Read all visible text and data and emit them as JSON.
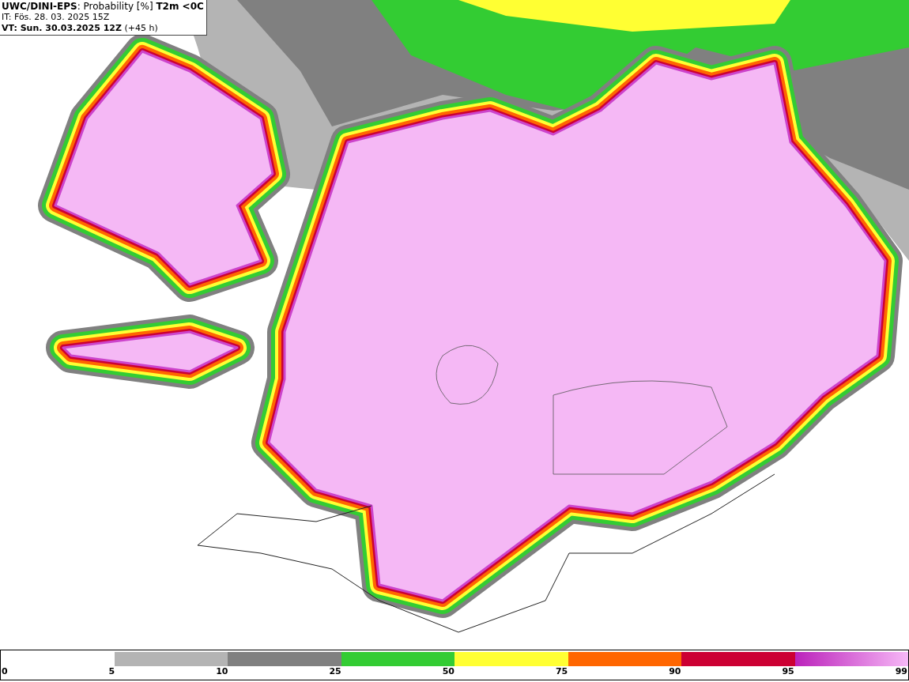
{
  "header": {
    "lines": [
      "**UWC/DINI-EPS**: Probability [%] **T2m <0C**",
      "IT: Fös. 28. 03. 2025 15Z",
      "**VT: Sun. 30.03.2025 12Z** (+45 h)"
    ]
  },
  "legend": {
    "segments": [
      {
        "color": "#ffffff"
      },
      {
        "color": "#b4b4b4"
      },
      {
        "color": "#808080"
      },
      {
        "color": "#33cc33"
      },
      {
        "color": "#ffff33"
      },
      {
        "color": "#ff6600"
      },
      {
        "color": "#cc0033"
      },
      {
        "kind": "gradient",
        "color": "#bb22bb"
      }
    ],
    "labels": [
      "0",
      "5",
      "10",
      "25",
      "50",
      "75",
      "90",
      "95",
      "99"
    ]
  }
}
